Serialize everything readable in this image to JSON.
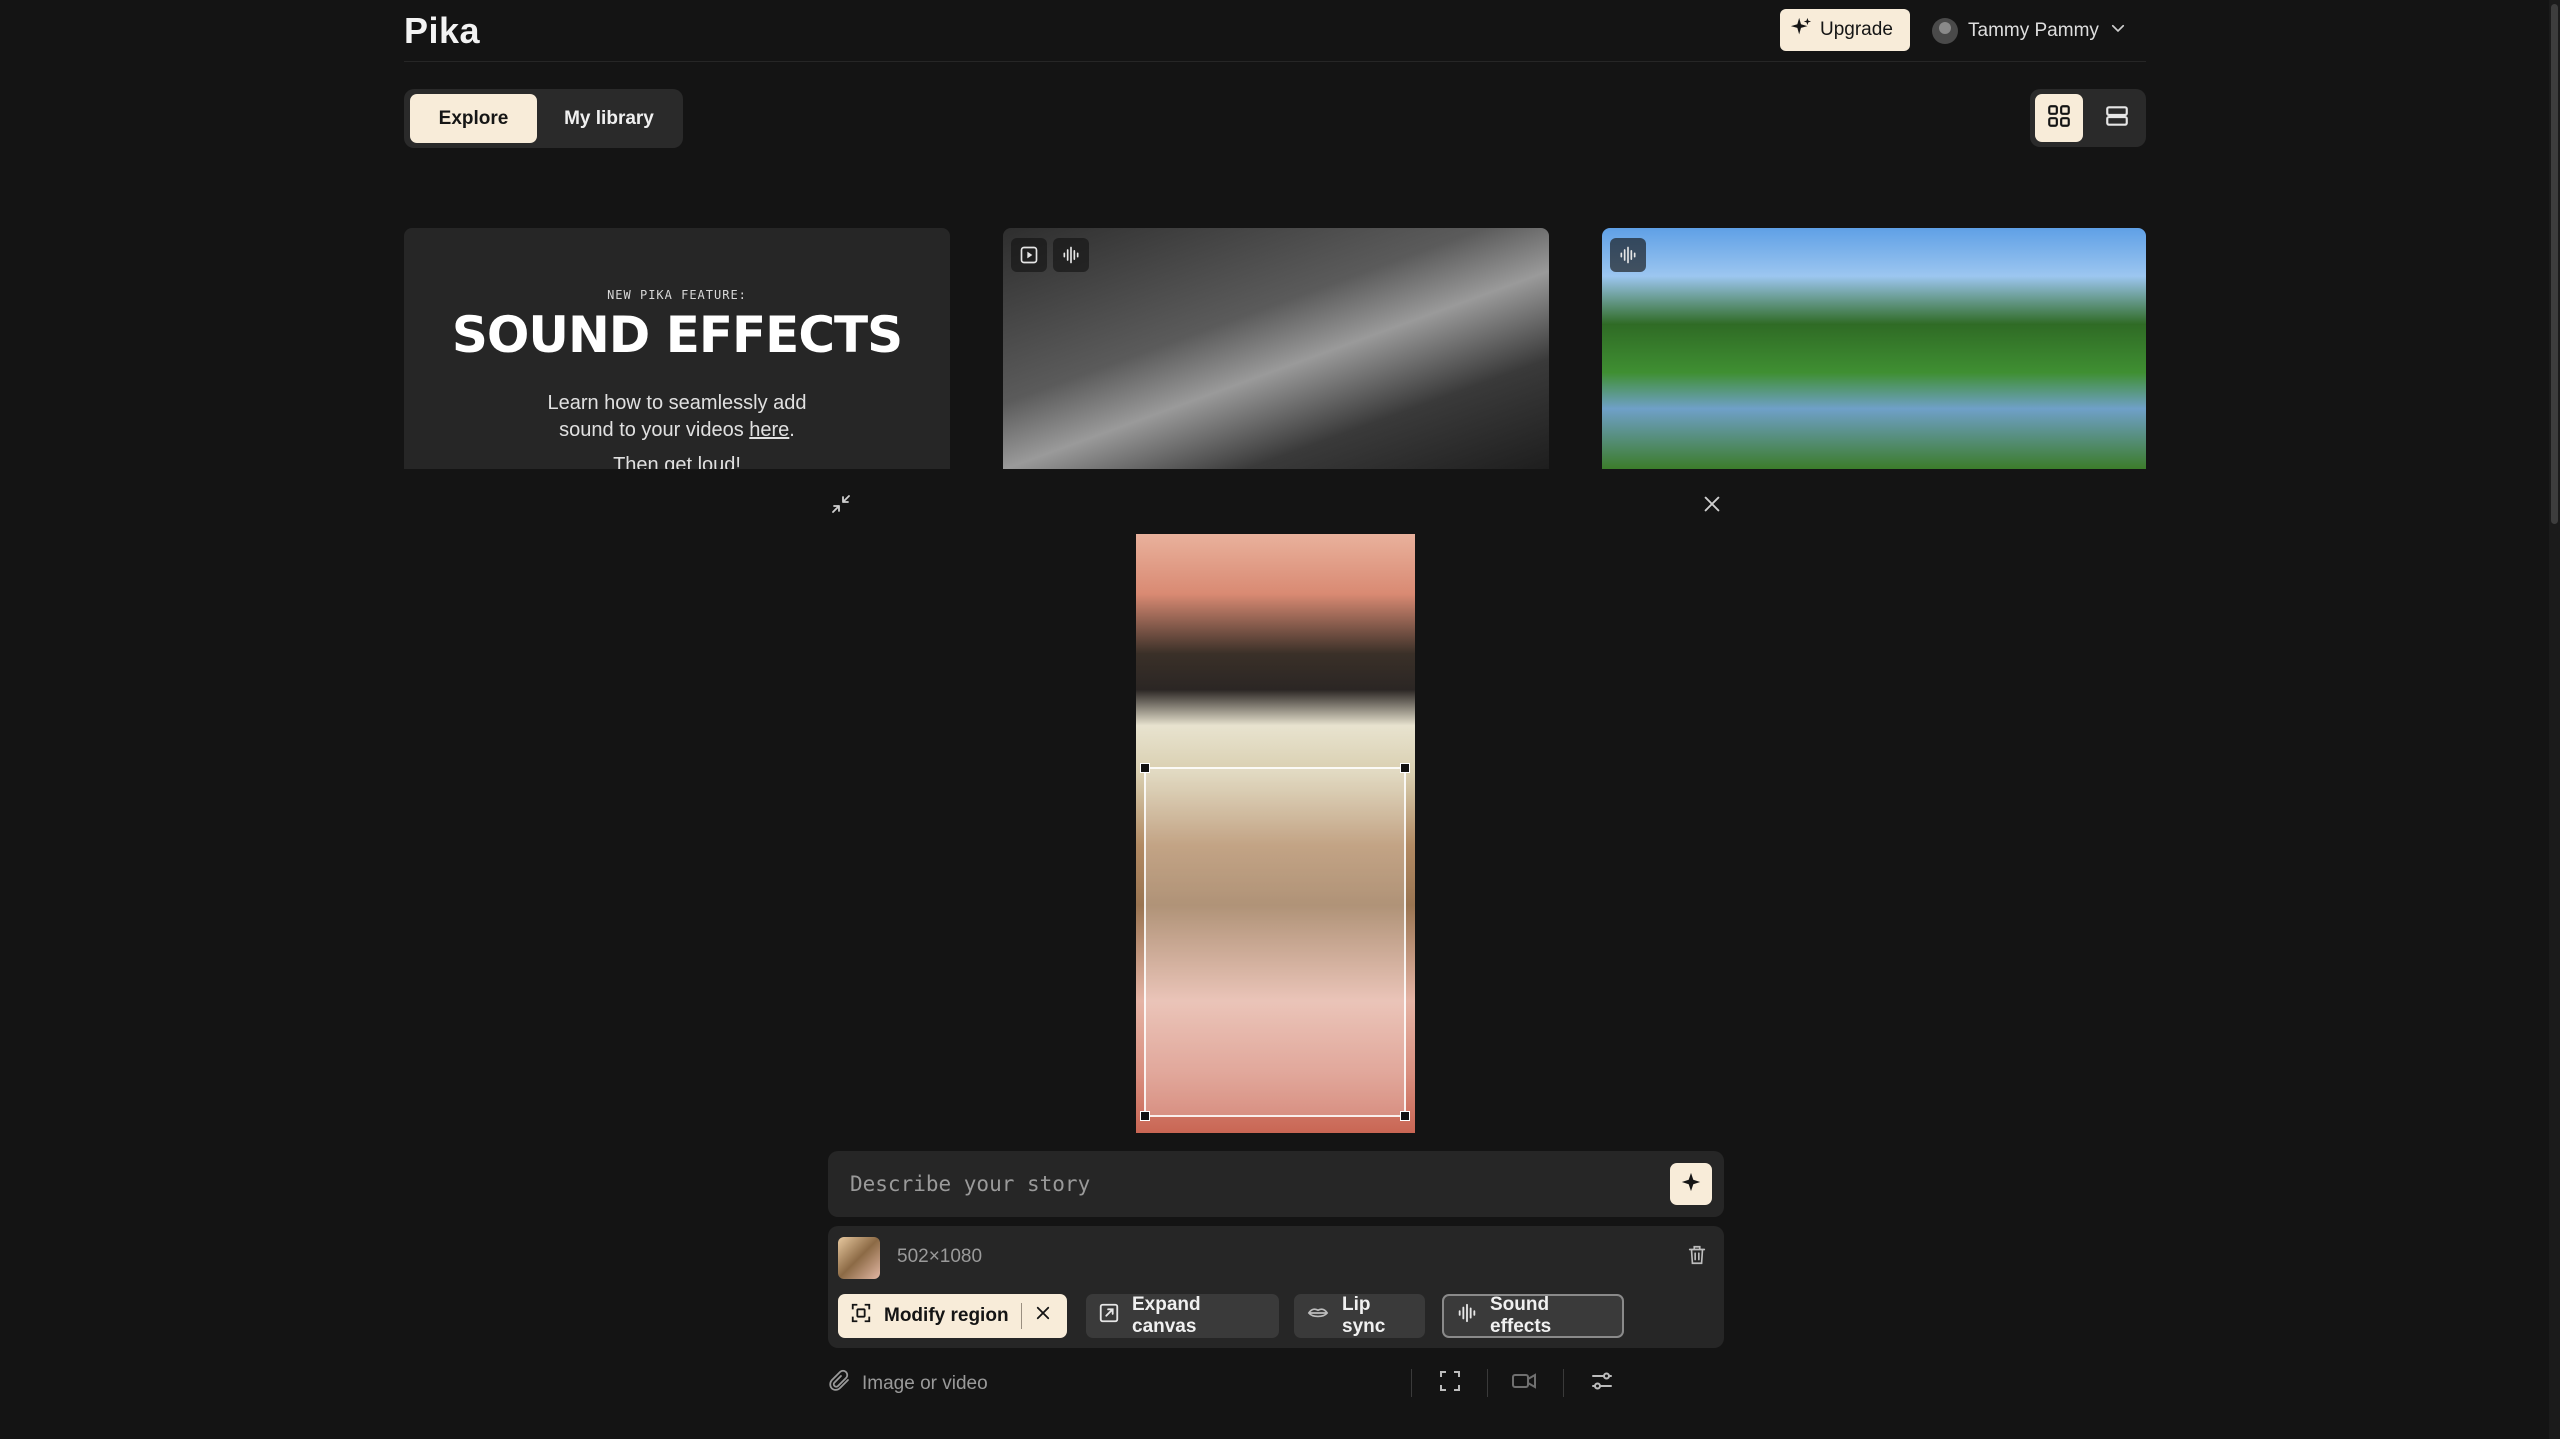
{
  "header": {
    "logo": "Pika",
    "upgrade_label": "Upgrade",
    "user_name": "Tammy Pammy"
  },
  "tabs": [
    {
      "label": "Explore",
      "active": true
    },
    {
      "label": "My library",
      "active": false
    }
  ],
  "view_toggle": {
    "selected": "grid"
  },
  "promo": {
    "kicker": "NEW PIKA FEATURE:",
    "title": "SOUND EFFECTS",
    "body_line1": "Learn how to seamlessly add",
    "body_line2_prefix": "sound to your videos ",
    "link": "here",
    "body_line2_suffix": ".",
    "footer": "Then get loud!"
  },
  "editor": {
    "prompt_placeholder": "Describe your story",
    "asset_size": "502×1080",
    "chips": {
      "modify_region": "Modify region",
      "expand_canvas": "Expand canvas",
      "lip_sync": "Lip sync",
      "sound_effects": "Sound effects"
    },
    "attach_label": "Image or video"
  },
  "colors": {
    "accent": "#f8ecd9",
    "background": "#141414",
    "panel": "#262626"
  }
}
